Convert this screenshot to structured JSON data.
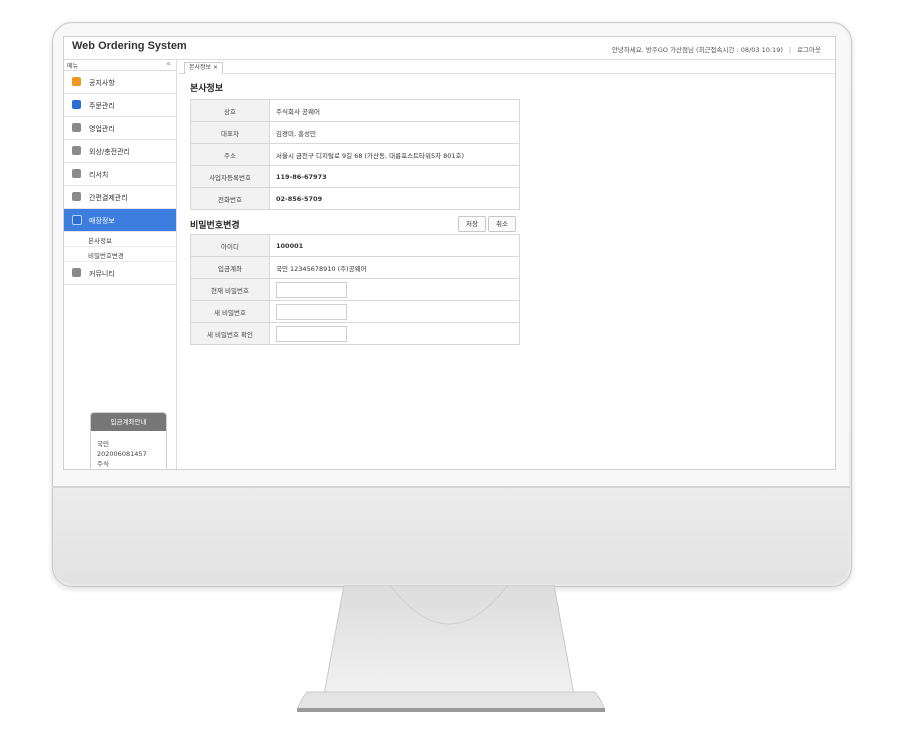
{
  "app": {
    "title": "Web Ordering System",
    "greeting": "안녕하세요. 방주GO 가산점님 (최근접속시간 : 08/03 10:19)",
    "separator": "|",
    "logout_label": "로그아웃"
  },
  "sidebar": {
    "menu_label": "메뉴",
    "collapse_glyph": "«",
    "items": [
      {
        "label": "공지사항",
        "color": "#f0961e"
      },
      {
        "label": "주문관리",
        "color": "#2b6fd6"
      },
      {
        "label": "영업관리",
        "color": "#8a8a8a"
      },
      {
        "label": "외상/충전관리",
        "color": "#8a8a8a"
      },
      {
        "label": "리서치",
        "color": "#8a8a8a"
      },
      {
        "label": "간편결제관리",
        "color": "#8a8a8a"
      },
      {
        "label": "매장정보",
        "color": "#2b6fd6"
      }
    ],
    "sub_items": [
      "본사정보",
      "비밀번호변경"
    ],
    "extra_item": {
      "label": "커뮤니티",
      "color": "#8a8a8a"
    },
    "bank_box": {
      "title": "입금계좌안내",
      "bank": "국민",
      "account": "202006081457",
      "holder": "주식"
    }
  },
  "tab": {
    "label": "본사정보 ×"
  },
  "hq_info": {
    "title": "본사정보",
    "rows": [
      {
        "label": "상호",
        "value": "주식회사 공웨어"
      },
      {
        "label": "대표자",
        "value": "김경미, 홍성민"
      },
      {
        "label": "주소",
        "value": "서울시 금천구 디지털로 9길 68 (가산동, 대륭포스트타워5차 801호)"
      },
      {
        "label": "사업자등록번호",
        "value": "119-86-67973"
      },
      {
        "label": "전화번호",
        "value": "02-856-5709"
      }
    ]
  },
  "password": {
    "title": "비밀번호변경",
    "save_label": "저장",
    "cancel_label": "취소",
    "rows": [
      {
        "label": "아이디",
        "value": "100001"
      },
      {
        "label": "입금계좌",
        "value": "국민 12345678910 (주)공웨어"
      },
      {
        "label": "현재 비밀번호",
        "value": ""
      },
      {
        "label": "새 비밀번호",
        "value": ""
      },
      {
        "label": "새 비밀번호 확인",
        "value": ""
      }
    ]
  },
  "colors": {
    "accent": "#3d7de0"
  }
}
